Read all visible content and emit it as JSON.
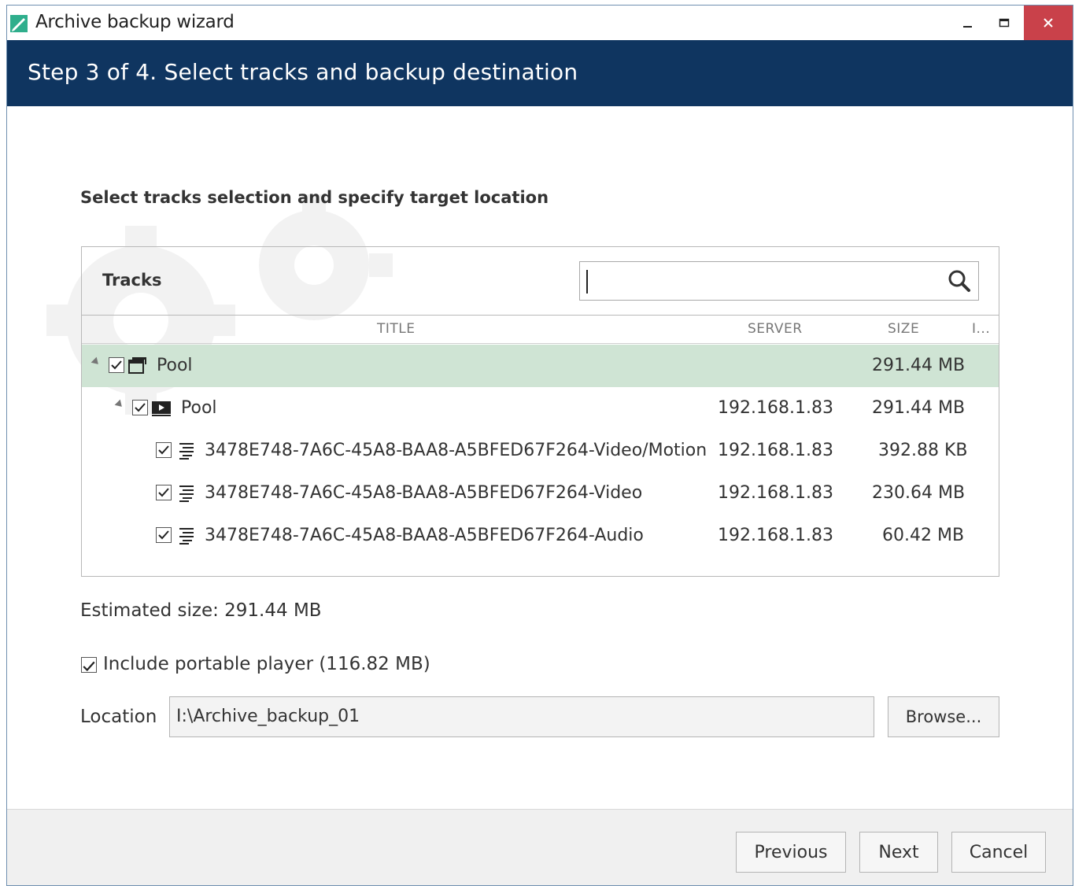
{
  "window": {
    "title": "Archive backup wizard"
  },
  "header": {
    "step_text": "Step 3 of 4. Select tracks and backup destination"
  },
  "section": {
    "title": "Select tracks selection and specify target location"
  },
  "tracks_panel": {
    "title": "Tracks",
    "search": {
      "value": "",
      "placeholder": ""
    },
    "columns": {
      "title": "TITLE",
      "server": "SERVER",
      "size": "SIZE",
      "extra": "I..."
    },
    "rows": [
      {
        "title": "Pool",
        "server": "",
        "size": "291.44 MB",
        "checked": true,
        "icon": "pool-group-icon",
        "level": 0,
        "expanded": true,
        "selected": true
      },
      {
        "title": "Pool",
        "server": "192.168.1.83",
        "size": "291.44 MB",
        "checked": true,
        "icon": "video-pool-icon",
        "level": 1,
        "expanded": true,
        "selected": false
      },
      {
        "title": "3478E748-7A6C-45A8-BAA8-A5BFED67F264-Video/Motion",
        "server": "192.168.1.83",
        "size": "392.88 KB",
        "checked": true,
        "icon": "track-icon",
        "level": 2,
        "selected": false
      },
      {
        "title": "3478E748-7A6C-45A8-BAA8-A5BFED67F264-Video",
        "server": "192.168.1.83",
        "size": "230.64 MB",
        "checked": true,
        "icon": "track-icon",
        "level": 2,
        "selected": false
      },
      {
        "title": "3478E748-7A6C-45A8-BAA8-A5BFED67F264-Audio",
        "server": "192.168.1.83",
        "size": "60.42 MB",
        "checked": true,
        "icon": "track-icon",
        "level": 2,
        "selected": false
      }
    ]
  },
  "estimate": {
    "text": "Estimated size: 291.44 MB"
  },
  "portable_player": {
    "label": "Include portable player (116.82 MB)",
    "checked": true
  },
  "location": {
    "label": "Location",
    "value": "I:\\Archive_backup_01",
    "browse_label": "Browse..."
  },
  "footer": {
    "previous_label": "Previous",
    "next_label": "Next",
    "cancel_label": "Cancel"
  },
  "colors": {
    "header_bg": "#0f3560",
    "selected_row": "#cfe4d4",
    "close_button": "#c9414a",
    "app_icon": "#2fae8c"
  }
}
